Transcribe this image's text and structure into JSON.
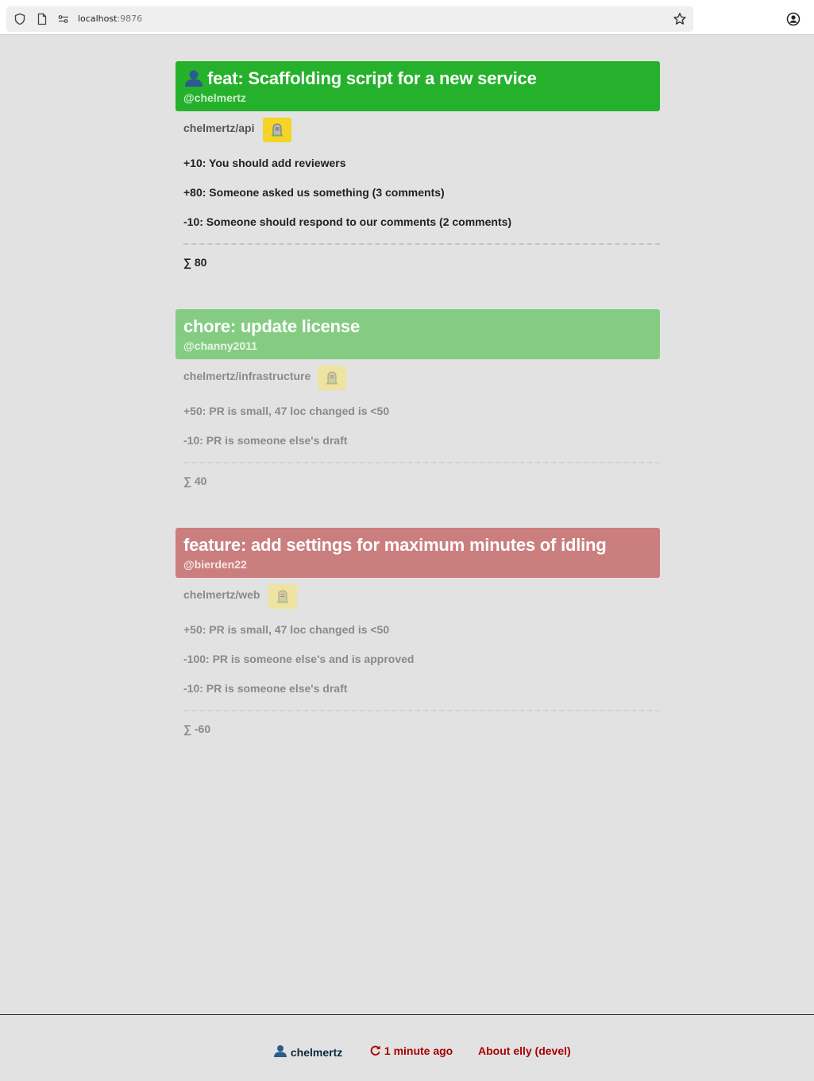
{
  "browser": {
    "url_host": "localhost",
    "url_port": ":9876"
  },
  "cards": [
    {
      "title_icon": "person-icon",
      "title": "feat: Scaffolding script for a new service",
      "author": "@chelmertz",
      "repo": "chelmertz/api",
      "header_color": "#25b12b",
      "author_color": "#c9f0ca",
      "reasons": [
        "+10: You should add reviewers",
        "+80: Someone asked us something (3 comments)",
        "-10: Someone should respond to our comments (2 comments)"
      ],
      "total": "∑ 80"
    },
    {
      "title": "chore: update license",
      "author": "@channy2011",
      "repo": "chelmertz/infrastructure",
      "header_color": "#85cc83",
      "author_color": "#e8f6e7",
      "reasons": [
        "+50: PR is small, 47 loc changed is <50",
        "-10: PR is someone else's draft"
      ],
      "total": "∑ 40"
    },
    {
      "title": "feature: add settings for maximum minutes of idling",
      "author": "@bierden22",
      "repo": "chelmertz/web",
      "header_color": "#cb7e7e",
      "author_color": "#f7e4e4",
      "reasons": [
        "+50: PR is small, 47 loc changed is <50",
        "-100: PR is someone else's and is approved",
        "-10: PR is someone else's draft"
      ],
      "total": "∑ -60"
    }
  ],
  "footer": {
    "user": "chelmertz",
    "refresh": "1 minute ago",
    "about": "About elly (devel)",
    "link_color": "#a80000",
    "user_color": "#0c2a3c"
  }
}
